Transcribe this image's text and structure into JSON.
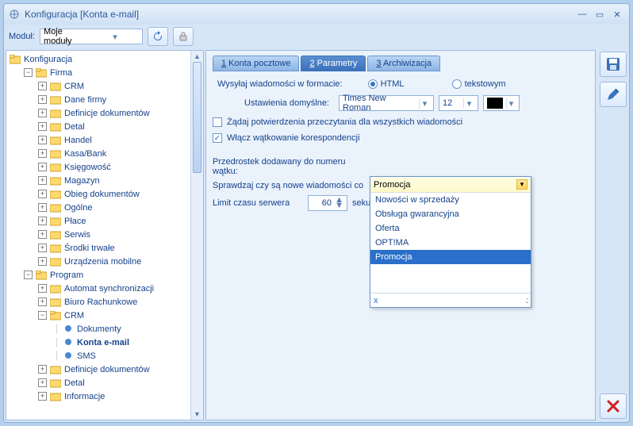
{
  "window": {
    "title": "Konfiguracja [Konta e-mail]"
  },
  "toolbar": {
    "module_label": "Moduł:",
    "module_value": "Moje moduły"
  },
  "tree": {
    "root": "Konfiguracja",
    "firma": {
      "label": "Firma",
      "items": [
        "CRM",
        "Dane firmy",
        "Definicje dokumentów",
        "Detal",
        "Handel",
        "Kasa/Bank",
        "Księgowość",
        "Magazyn",
        "Obieg dokumentów",
        "Ogólne",
        "Płace",
        "Serwis",
        "Środki trwałe",
        "Urządzenia mobilne"
      ]
    },
    "program": {
      "label": "Program",
      "items": [
        "Automat synchronizacji",
        "Biuro Rachunkowe"
      ],
      "crm": {
        "label": "CRM",
        "items": [
          "Dokumenty",
          "Konta e-mail",
          "SMS"
        ]
      },
      "rest": [
        "Definicje dokumentów",
        "Detal",
        "Informacje"
      ]
    }
  },
  "tabs": {
    "t1_n": "1",
    "t1": " Konta pocztowe",
    "t2_n": "2",
    "t2": " Parametry",
    "t3_n": "3",
    "t3": " Archiwizacja"
  },
  "params": {
    "format_label": "Wysyłaj wiadomości w formacie:",
    "format_html": "HTML",
    "format_text": "tekstowym",
    "defaults_label": "Ustawienia domyślne:",
    "font": "Times New Roman",
    "size": "12",
    "chk1": "Żądaj potwierdzenia przeczytania dla wszystkich wiadomości",
    "chk2": "Włącz wątkowanie korespondencji",
    "prefix_label": "Przedrostek dodawany do numeru wątku:",
    "poll_label": "Sprawdzaj czy są nowe wiadomości co",
    "timeout_label": "Limit czasu serwera",
    "timeout_value": "60",
    "timeout_unit": "sekund"
  },
  "dropdown": {
    "value": "Promocja",
    "options": [
      "Nowości w sprzedaży",
      "Obsługa gwarancyjna",
      "Oferta",
      "OPT!MA",
      "Promocja"
    ],
    "close": "x"
  }
}
